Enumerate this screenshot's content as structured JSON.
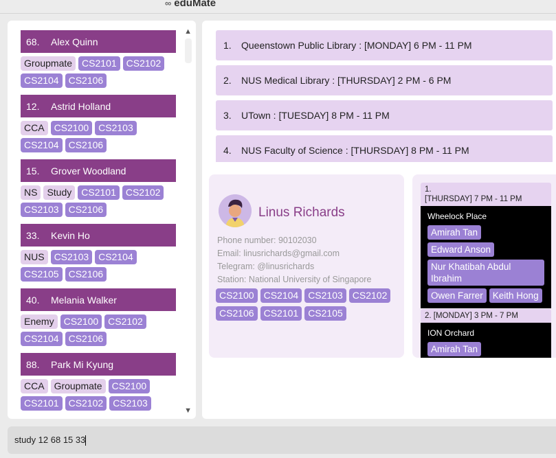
{
  "app": {
    "title": "eduMate"
  },
  "persons": [
    {
      "index": "68.",
      "name": "Alex Quinn",
      "tags": [
        "Groupmate"
      ],
      "modules": [
        "CS2101",
        "CS2102",
        "CS2104",
        "CS2106"
      ]
    },
    {
      "index": "12.",
      "name": "Astrid Holland",
      "tags": [
        "CCA"
      ],
      "modules": [
        "CS2100",
        "CS2103",
        "CS2104",
        "CS2106"
      ]
    },
    {
      "index": "15.",
      "name": "Grover Woodland",
      "tags": [
        "NS",
        "Study"
      ],
      "modules": [
        "CS2101",
        "CS2102",
        "CS2103",
        "CS2106"
      ]
    },
    {
      "index": "33.",
      "name": "Kevin Ho",
      "tags": [
        "NUS"
      ],
      "modules": [
        "CS2103",
        "CS2104",
        "CS2105",
        "CS2106"
      ]
    },
    {
      "index": "40.",
      "name": "Melania Walker",
      "tags": [
        "Enemy"
      ],
      "modules": [
        "CS2100",
        "CS2102",
        "CS2104",
        "CS2106"
      ]
    },
    {
      "index": "88.",
      "name": "Park Mi Kyung",
      "tags": [
        "CCA",
        "Groupmate"
      ],
      "modules": [
        "CS2100",
        "CS2101",
        "CS2102",
        "CS2103"
      ]
    }
  ],
  "libraries": [
    {
      "num": "1.",
      "text": "Queenstown Public Library : [MONDAY] 6 PM - 11 PM"
    },
    {
      "num": "2.",
      "text": "NUS Medical Library : [THURSDAY] 2 PM - 6 PM"
    },
    {
      "num": "3.",
      "text": "UTown : [TUESDAY] 8 PM - 11 PM"
    },
    {
      "num": "4.",
      "text": "NUS Faculty of Science : [THURSDAY] 8 PM - 11 PM"
    }
  ],
  "profile": {
    "name": "Linus Richards",
    "phone": "Phone number: 90102030",
    "email": "Email: linusrichards@gmail.com",
    "telegram": "Telegram: @linusrichards",
    "station": "Station: National University of Singapore",
    "modules": [
      "CS2100",
      "CS2104",
      "CS2103",
      "CS2102",
      "CS2106",
      "CS2101",
      "CS2105"
    ]
  },
  "meetups": [
    {
      "num": "1.",
      "time": "[THURSDAY] 7 PM - 11 PM",
      "place": "Wheelock Place",
      "participants": [
        "Amirah Tan",
        "Edward Anson",
        "Nur Khatibah Abdul Ibrahim",
        "Owen Farrer",
        "Keith Hong"
      ]
    },
    {
      "header": "2. [MONDAY] 3 PM - 7 PM",
      "place": "ION Orchard",
      "participants": [
        "Amirah Tan"
      ]
    }
  ],
  "command": {
    "value": "study 12 68 15 33"
  },
  "colors": {
    "accent": "#893e88",
    "module_tag": "#9b81d4",
    "category_tag": "#e3cfeb",
    "library_item": "#e6d3f0"
  }
}
